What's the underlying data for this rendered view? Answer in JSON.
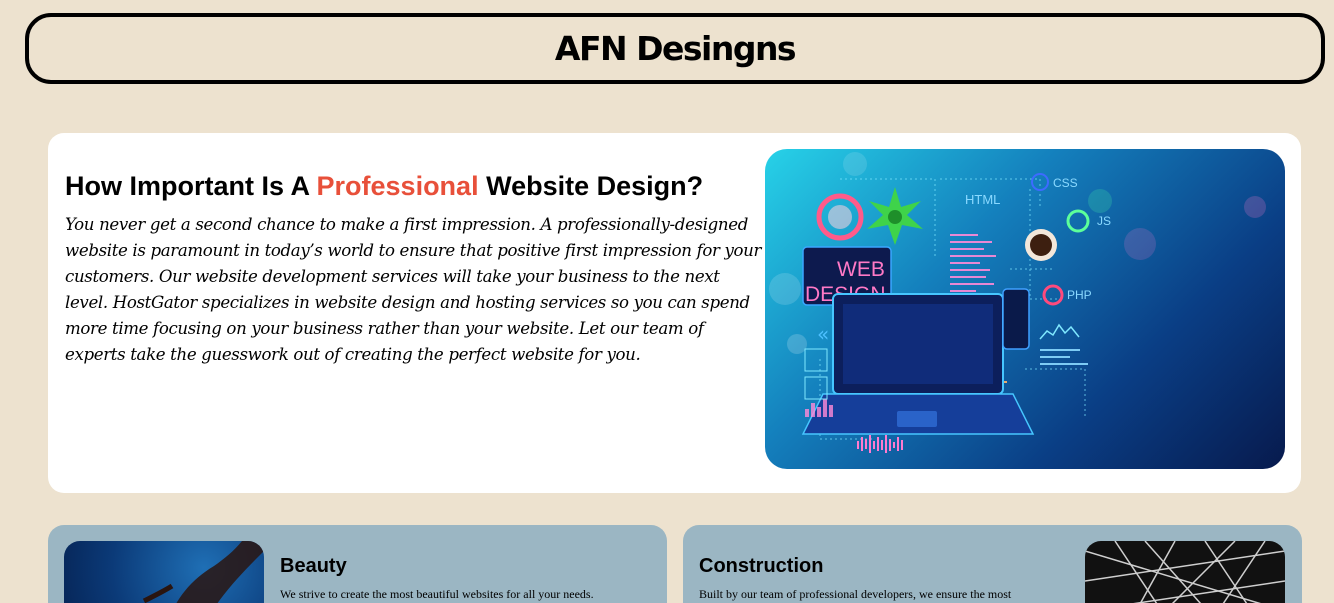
{
  "header": {
    "title": "AFN Desingns"
  },
  "hero": {
    "heading_before": "How Important Is A ",
    "heading_accent": "Professional",
    "heading_after": " Website Design?",
    "body": "You never get a second chance to make a first impression. A professionally-designed website is paramount in today’s world to ensure that positive first impression for your customers. Our website development services will take your business to the next level. HostGator specializes in website design and hosting services so you can spend more time focusing on your business rather than your website. Let our team of experts take the guesswork out of creating the perfect website for you.",
    "image": {
      "labels": {
        "web": "WEB",
        "design": "DESIGN",
        "html": "HTML",
        "css": "CSS",
        "js": "JS",
        "php": "PHP"
      }
    }
  },
  "cards": [
    {
      "title": "Beauty",
      "text": "We strive to create the most beautiful websites for all your needs."
    },
    {
      "title": "Construction",
      "text": "Built by our team of professional developers, we ensure the most"
    }
  ],
  "colors": {
    "background": "#ede2cf",
    "accent": "#e8503a",
    "card": "#9bb6c3"
  }
}
